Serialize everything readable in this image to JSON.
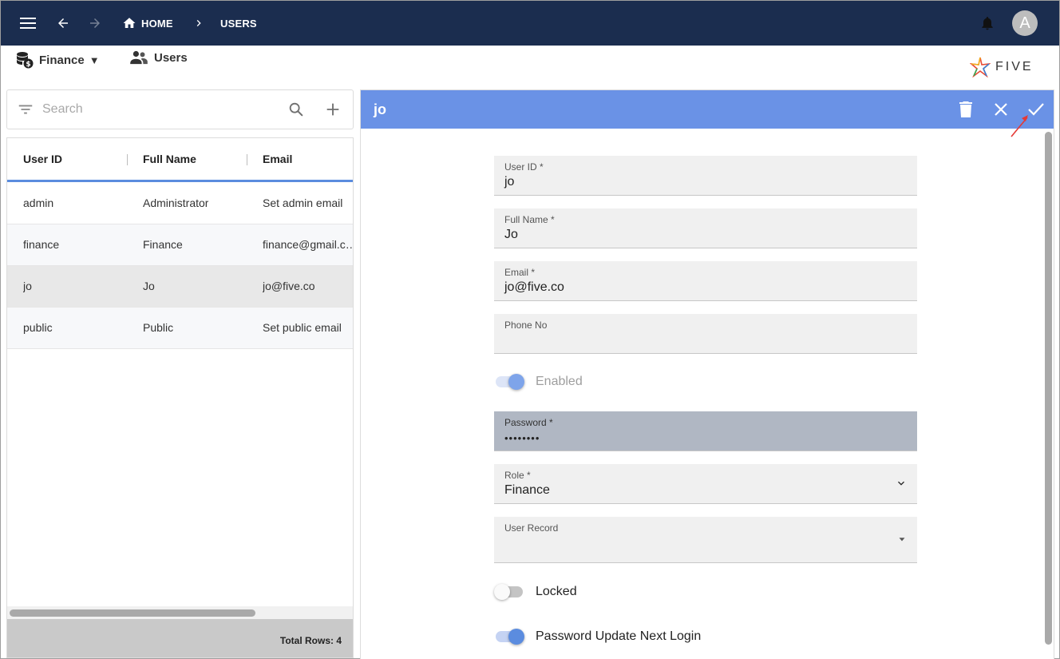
{
  "topbar": {
    "breadcrumb_home": "HOME",
    "breadcrumb_current": "USERS",
    "avatar_letter": "A",
    "bg_color": "#1b2d4f"
  },
  "subheader": {
    "app_name": "Finance",
    "app_caret": "▼",
    "users_label": "Users",
    "logo_text": "FIVE"
  },
  "search": {
    "placeholder": "Search"
  },
  "list": {
    "columns": [
      "User ID",
      "Full Name",
      "Email"
    ],
    "rows": [
      {
        "user_id": "admin",
        "full_name": "Administrator",
        "email": "Set admin email"
      },
      {
        "user_id": "finance",
        "full_name": "Finance",
        "email": "finance@gmail.c…"
      },
      {
        "user_id": "jo",
        "full_name": "Jo",
        "email": "jo@five.co"
      },
      {
        "user_id": "public",
        "full_name": "Public",
        "email": "Set public email"
      }
    ],
    "selected_row": 2,
    "footer": "Total Rows: 4"
  },
  "form": {
    "title": "jo",
    "header_color": "#6a92e6",
    "fields": {
      "user_id": {
        "label": "User ID *",
        "value": "jo"
      },
      "full_name": {
        "label": "Full Name *",
        "value": "Jo"
      },
      "email": {
        "label": "Email *",
        "value": "jo@five.co"
      },
      "phone": {
        "label": "Phone No",
        "value": ""
      },
      "password": {
        "label": "Password *",
        "value": "••••••••"
      },
      "role": {
        "label": "Role *",
        "value": "Finance"
      },
      "user_record": {
        "label": "User Record",
        "value": ""
      }
    },
    "toggles": {
      "enabled": {
        "label": "Enabled",
        "on": true,
        "disabled": true
      },
      "locked": {
        "label": "Locked",
        "on": false
      },
      "password_update": {
        "label": "Password Update Next Login",
        "on": true
      }
    },
    "accent_color": "#5b8cdf"
  }
}
